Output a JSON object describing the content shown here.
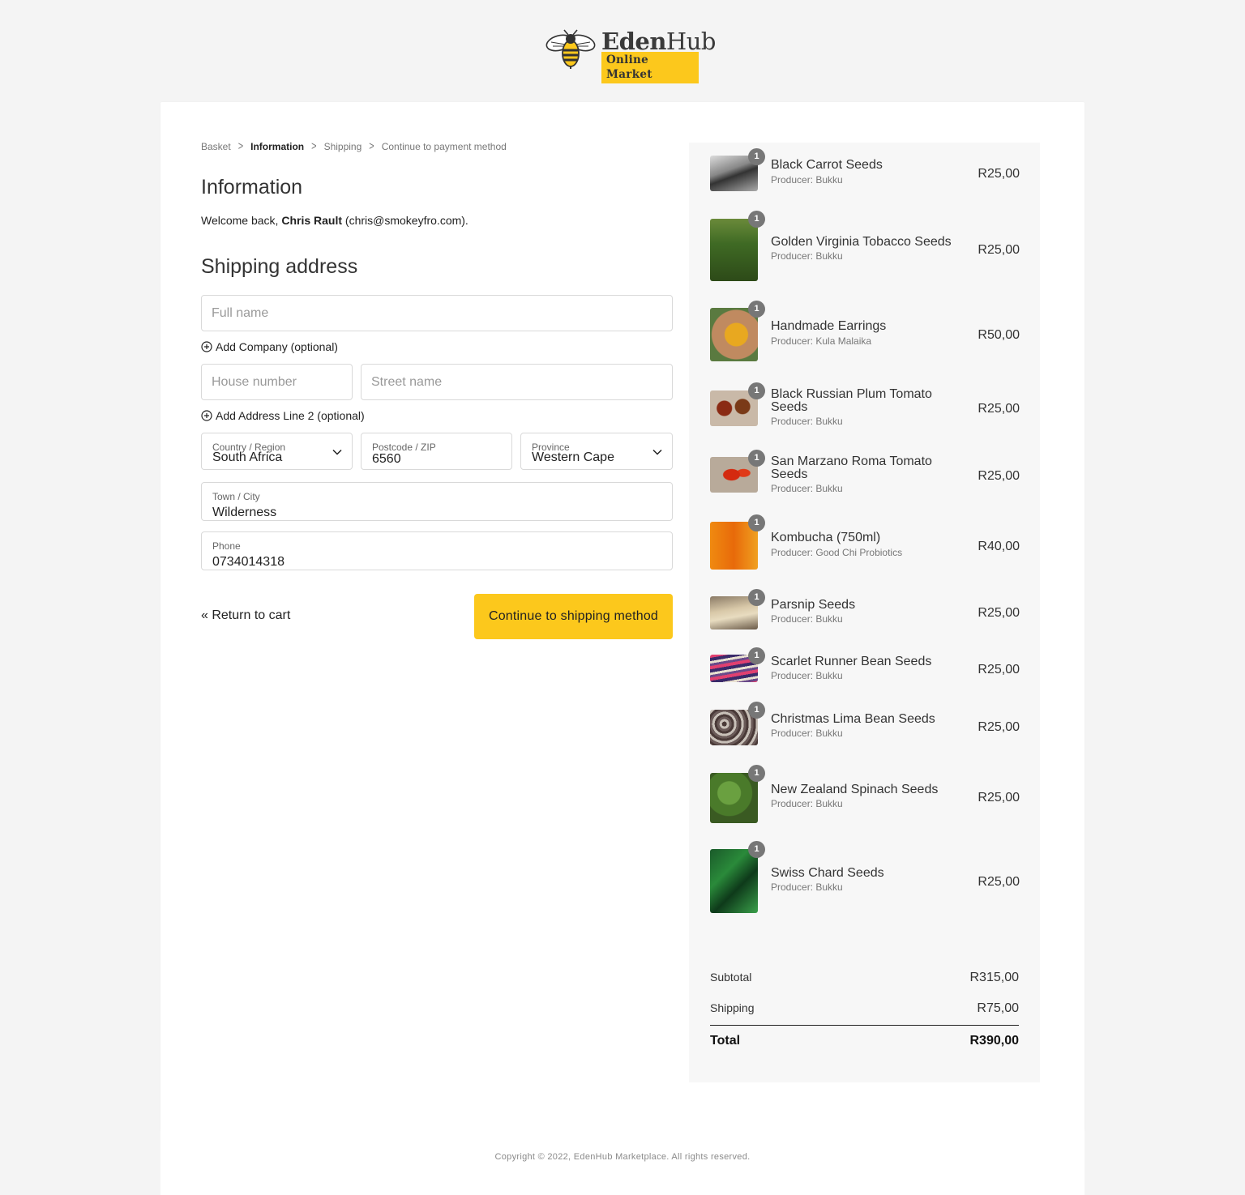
{
  "brand": {
    "name_bold": "Eden",
    "name_rest": "Hub",
    "tagline": "Online Market",
    "accent": "#fcc81c"
  },
  "breadcrumb": [
    "Basket",
    "Information",
    "Shipping",
    "Continue to payment method"
  ],
  "info": {
    "heading": "Information",
    "welcome_prefix": "Welcome back, ",
    "user_name": "Chris Rault",
    "user_email": " (chris@smokeyfro.com)."
  },
  "shipping": {
    "heading": "Shipping address",
    "full_name_placeholder": "Full name",
    "add_company": "Add Company (optional)",
    "house_placeholder": "House number",
    "street_placeholder": "Street name",
    "add_address2": "Add Address Line 2 (optional)",
    "country_label": "Country / Region",
    "country_value": "South Africa",
    "postcode_label": "Postcode / ZIP",
    "postcode_value": "6560",
    "province_label": "Province",
    "province_value": "Western Cape",
    "town_label": "Town / City",
    "town_value": "Wilderness",
    "phone_label": "Phone",
    "phone_value": "0734014318"
  },
  "actions": {
    "return": "« Return to cart",
    "continue": "Continue to shipping method"
  },
  "items": [
    {
      "name": "Black Carrot Seeds",
      "producer": "Producer: Bukku",
      "price": "R25,00",
      "qty": "1"
    },
    {
      "name": "Golden Virginia Tobacco Seeds",
      "producer": "Producer: Bukku",
      "price": "R25,00",
      "qty": "1"
    },
    {
      "name": "Handmade Earrings",
      "producer": "Producer: Kula Malaika",
      "price": "R50,00",
      "qty": "1"
    },
    {
      "name": "Black Russian Plum Tomato Seeds",
      "producer": "Producer: Bukku",
      "price": "R25,00",
      "qty": "1"
    },
    {
      "name": "San Marzano Roma Tomato Seeds",
      "producer": "Producer: Bukku",
      "price": "R25,00",
      "qty": "1"
    },
    {
      "name": "Kombucha (750ml)",
      "producer": "Producer: Good Chi Probiotics",
      "price": "R40,00",
      "qty": "1"
    },
    {
      "name": "Parsnip Seeds",
      "producer": "Producer: Bukku",
      "price": "R25,00",
      "qty": "1"
    },
    {
      "name": "Scarlet Runner Bean Seeds",
      "producer": "Producer: Bukku",
      "price": "R25,00",
      "qty": "1"
    },
    {
      "name": "Christmas Lima Bean Seeds",
      "producer": "Producer: Bukku",
      "price": "R25,00",
      "qty": "1"
    },
    {
      "name": "New Zealand Spinach Seeds",
      "producer": "Producer: Bukku",
      "price": "R25,00",
      "qty": "1"
    },
    {
      "name": "Swiss Chard Seeds",
      "producer": "Producer: Bukku",
      "price": "R25,00",
      "qty": "1"
    }
  ],
  "totals": {
    "subtotal_label": "Subtotal",
    "subtotal": "R315,00",
    "shipping_label": "Shipping",
    "shipping": "R75,00",
    "total_label": "Total",
    "total": "R390,00"
  },
  "footer": {
    "copyright": "Copyright © 2022, EdenHub Marketplace. All rights reserved."
  }
}
